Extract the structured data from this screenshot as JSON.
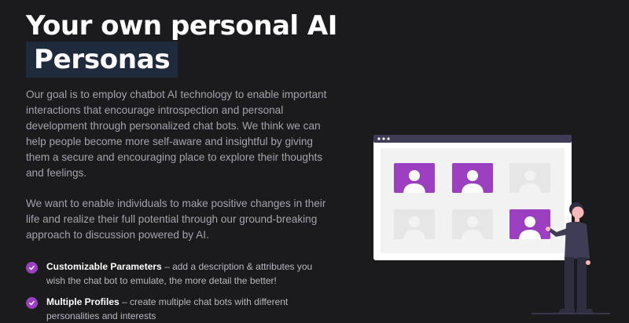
{
  "hero": {
    "title": "Your own personal AI",
    "highlight": "Personas"
  },
  "intro": {
    "paragraph1": "Our goal is to employ chatbot AI technology to enable important interactions that encourage introspection and personal development through personalized chat bots. We think we can help people become more self-aware and insightful by giving them a secure and encouraging place to explore their thoughts and feelings.",
    "paragraph2": "We want to enable individuals to make positive changes in their life and realize their full potential through our ground-breaking approach to discussion powered by AI."
  },
  "features": [
    {
      "title": "Customizable Parameters",
      "description": " – add a description & attributes you wish the chat bot to emulate, the more detail the better!"
    },
    {
      "title": "Multiple Profiles",
      "description": " – create multiple chat bots with different personalities and interests"
    }
  ],
  "colors": {
    "background": "#1b1b1e",
    "accent": "#9b3fc0",
    "highlight_bg": "#1f2b3c"
  },
  "illustration": {
    "profile_cards": [
      {
        "active": true
      },
      {
        "active": true
      },
      {
        "active": false
      },
      {
        "active": false
      },
      {
        "active": false
      },
      {
        "active": true
      }
    ]
  }
}
